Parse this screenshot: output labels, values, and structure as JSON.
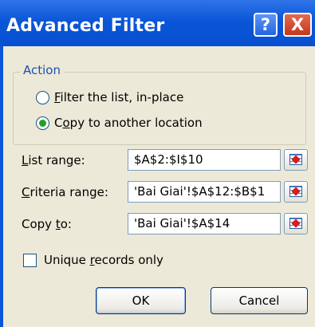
{
  "window": {
    "title": "Advanced Filter",
    "help_glyph": "?",
    "close_glyph": "X"
  },
  "action_group": {
    "legend": "Action",
    "options": [
      {
        "label_before": "",
        "mnemonic": "F",
        "label_after": "ilter the list, in-place",
        "selected": false
      },
      {
        "label_before": "C",
        "mnemonic": "o",
        "label_after": "py to another location",
        "selected": true
      }
    ]
  },
  "fields": {
    "list_range": {
      "label_before": "",
      "mnemonic": "L",
      "label_after": "ist range:",
      "value": "$A$2:$I$10"
    },
    "criteria_range": {
      "label_before": "",
      "mnemonic": "C",
      "label_after": "riteria range:",
      "value": "'Bai Giai'!$A$12:$B$1"
    },
    "copy_to": {
      "label_before": "Copy ",
      "mnemonic": "t",
      "label_after": "o:",
      "value": "'Bai Giai'!$A$14"
    }
  },
  "unique_records": {
    "label_before": "Unique ",
    "mnemonic": "r",
    "label_after": "ecords only",
    "checked": false
  },
  "buttons": {
    "ok": "OK",
    "cancel": "Cancel"
  },
  "colors": {
    "title_bar": "#0b56d8",
    "dialog_face": "#ece9d8",
    "legend_text": "#1b4fb5",
    "radio_dot": "#21a121"
  }
}
